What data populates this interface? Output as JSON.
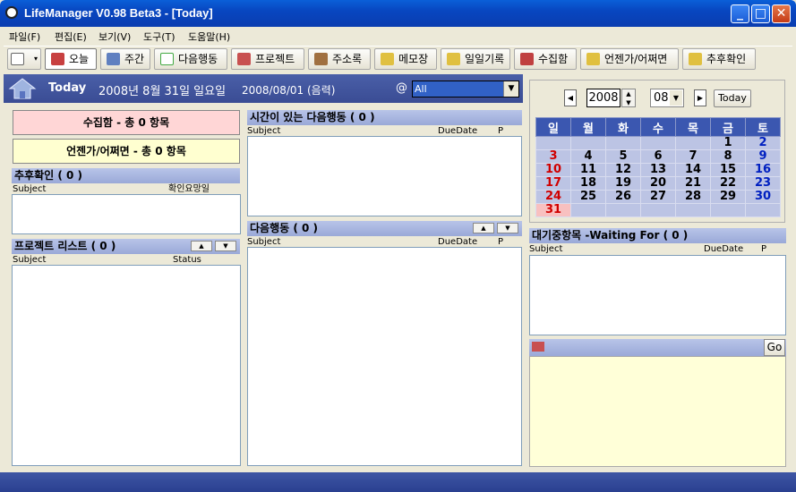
{
  "window": {
    "title": "LifeManager V0.98 Beta3 - [Today]",
    "min": "_",
    "max": "□",
    "close": "✕"
  },
  "menu": [
    "파일(F)",
    "편집(E)",
    "보기(V)",
    "도구(T)",
    "도움말(H)"
  ],
  "toolbar": [
    "오늘",
    "주간",
    "다음행동",
    "프로젝트",
    "주소록",
    "메모장",
    "일일기록",
    "수집함",
    "언젠가/어쩌면",
    "추후확인"
  ],
  "header": {
    "today": "Today",
    "date": "2008년 8월 31일 일요일",
    "lunar": "2008/08/01 (음력)",
    "at": "@",
    "filter": "All"
  },
  "left": {
    "inbox": "수집함 - 총 0 항목",
    "someday": "언젠가/어쩌면 - 총 0 항목",
    "followup": {
      "title": "추후확인 ( 0 )",
      "col1": "Subject",
      "col2": "확인요망일"
    },
    "projects": {
      "title": "프로젝트 리스트 ( 0 )",
      "col1": "Subject",
      "col2": "Status"
    }
  },
  "middle": {
    "timed": {
      "title": "시간이 있는 다음행동 ( 0 )",
      "col1": "Subject",
      "col2": "DueDate",
      "col3": "P"
    },
    "next": {
      "title": "다음행동 ( 0 )",
      "col1": "Subject",
      "col2": "DueDate",
      "col3": "P"
    }
  },
  "calendar": {
    "year": "2008",
    "month": "08",
    "today_button": "Today",
    "weekdays": [
      "일",
      "월",
      "화",
      "수",
      "목",
      "금",
      "토"
    ],
    "weeks": [
      [
        "",
        "",
        "",
        "",
        "",
        "1",
        "2"
      ],
      [
        "3",
        "4",
        "5",
        "6",
        "7",
        "8",
        "9"
      ],
      [
        "10",
        "11",
        "12",
        "13",
        "14",
        "15",
        "16"
      ],
      [
        "17",
        "18",
        "19",
        "20",
        "21",
        "22",
        "23"
      ],
      [
        "24",
        "25",
        "26",
        "27",
        "28",
        "29",
        "30"
      ],
      [
        "31",
        "",
        "",
        "",
        "",
        "",
        ""
      ]
    ]
  },
  "waiting": {
    "title": "대기중항목 -Waiting For ( 0 )",
    "col1": "Subject",
    "col2": "DueDate",
    "col3": "P"
  },
  "memo": {
    "go": "Go"
  },
  "colors": {
    "header": "#3a4c94",
    "panel_bar": "#9aa9d8",
    "calendar_head": "#3b57b0",
    "sunday": "#d00000",
    "saturday": "#0020c0",
    "memo_bg": "#ffffd8"
  }
}
